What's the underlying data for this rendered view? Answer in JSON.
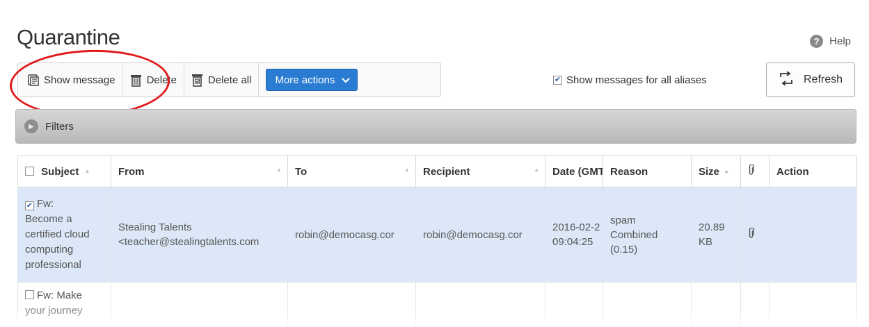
{
  "page": {
    "title": "Quarantine",
    "help_label": "Help"
  },
  "toolbar": {
    "show_message_label": "Show message",
    "delete_label": "Delete",
    "delete_all_label": "Delete all",
    "more_actions_label": "More actions",
    "aliases_label": "Show messages for all aliases",
    "aliases_checked": true,
    "refresh_label": "Refresh"
  },
  "filters": {
    "label": "Filters"
  },
  "table": {
    "columns": [
      "Subject",
      "From",
      "To",
      "Recipient",
      "Date (GMT",
      "Reason",
      "Size",
      "",
      "Action"
    ],
    "rows": [
      {
        "checked": true,
        "subject_lines": [
          "Fw:",
          "Become a",
          "certified cloud",
          "computing",
          "professional"
        ],
        "from_name": "Stealing Talents",
        "from_email": "<teacher@stealingtalents.com",
        "to": "robin@democasg.cor",
        "recipient": "robin@democasg.cor",
        "date": "2016-02-2",
        "time": "09:04:25",
        "reason_lines": [
          "spam",
          "Combined",
          "(0.15)"
        ],
        "size_lines": [
          "20.89",
          "KB"
        ],
        "has_attachment": true,
        "action": ""
      },
      {
        "checked": false,
        "subject_lines": [
          "Fw: Make",
          "your journey"
        ]
      }
    ]
  },
  "icons": {
    "show_message": "document-lines-icon",
    "delete": "trash-icon",
    "delete_all": "trash-all-icon",
    "more_actions": "chevron-down-icon",
    "refresh": "refresh-icon",
    "filters": "expand-arrow-icon",
    "attachment": "paperclip-icon",
    "help": "question-icon"
  },
  "colors": {
    "accent": "#2a7cd2",
    "selected_row": "#dce8f7",
    "annotation": "#e01b1b"
  }
}
